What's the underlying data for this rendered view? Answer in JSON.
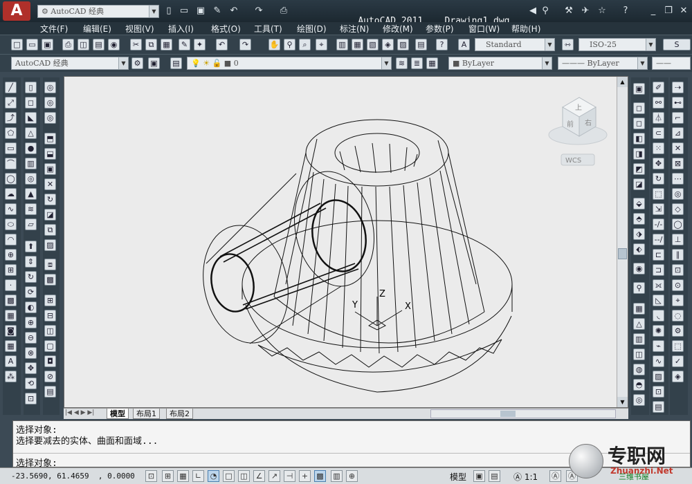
{
  "titlebar": {
    "workspace": "AutoCAD 经典",
    "app_name": "AutoCAD 2011",
    "doc_name": "Drawing1.dwg"
  },
  "menu": [
    "文件(F)",
    "编辑(E)",
    "视图(V)",
    "插入(I)",
    "格式(O)",
    "工具(T)",
    "绘图(D)",
    "标注(N)",
    "修改(M)",
    "参数(P)",
    "窗口(W)",
    "帮助(H)"
  ],
  "styles": {
    "text_style": "Standard",
    "dim_style": "ISO-25"
  },
  "layers": {
    "workspace": "AutoCAD 经典",
    "layer": "0",
    "color": "ByLayer",
    "linetype": "ByLayer"
  },
  "viewcube": {
    "wcs_label": "WCS",
    "top_label": "上",
    "front_label": "前",
    "right_label": "右"
  },
  "ucs": {
    "x": "X",
    "y": "Y",
    "z": "Z"
  },
  "layout_tabs": [
    "模型",
    "布局1",
    "布局2"
  ],
  "command": {
    "history": [
      "选择对象:",
      "选择要减去的实体、曲面和面域..."
    ],
    "prompt": "选择对象:"
  },
  "status": {
    "coords": "-23.5690, 61.4659  , 0.0000",
    "model_label": "模型",
    "scale": "1:1",
    "workspace_label": "三维书屋"
  },
  "watermark": {
    "brand": "专职网",
    "url": "Zhuanzhi.Net"
  },
  "colors": {
    "accent": "#c23a2e",
    "viewport_bg": "#ebebeb",
    "chrome": "#33414b"
  }
}
